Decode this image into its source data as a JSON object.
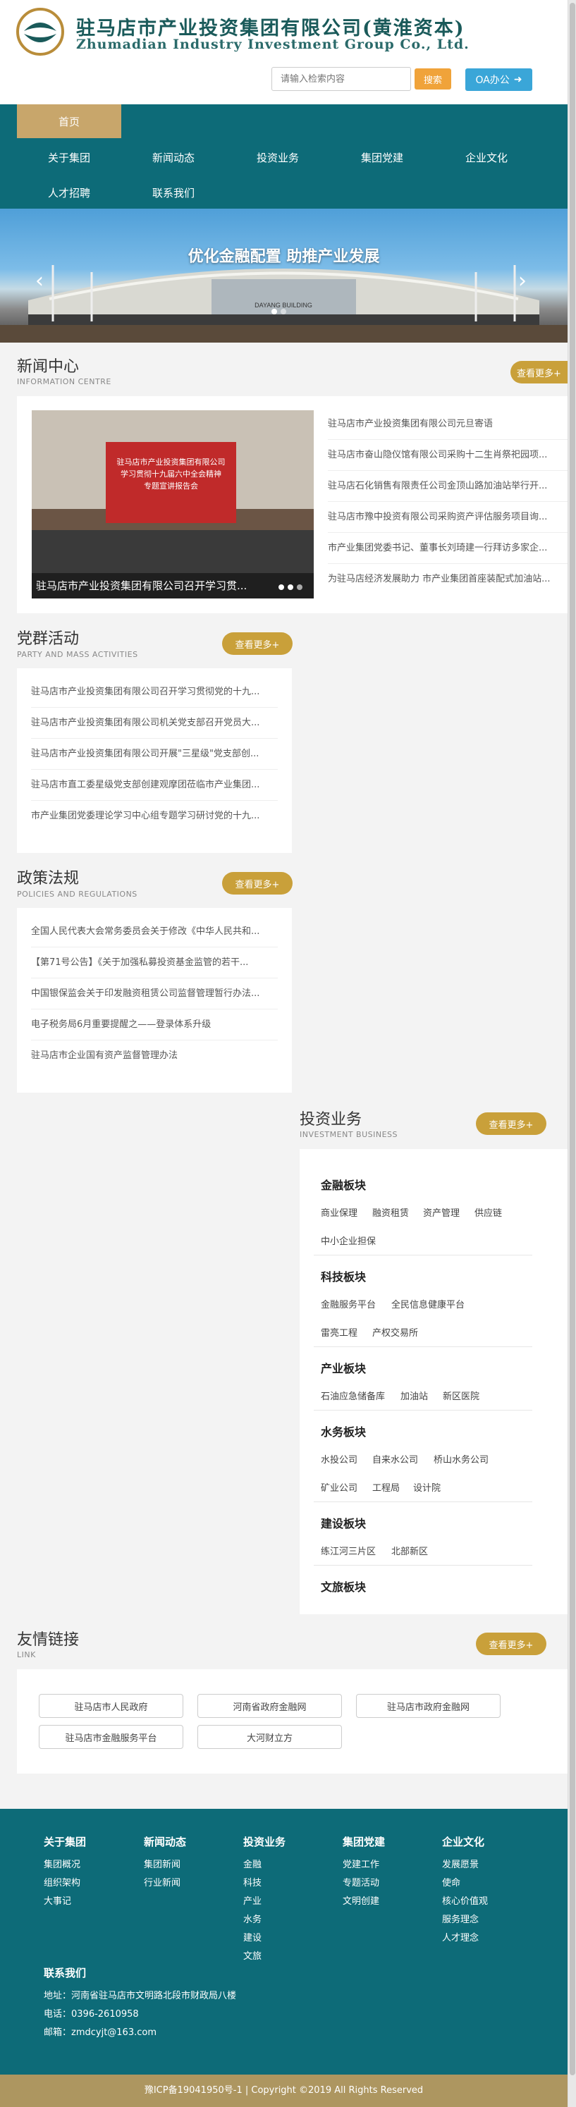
{
  "header": {
    "title_cn": "驻马店市产业投资集团有限公司(黄淮资本)",
    "title_en": "Zhumadian Industry Investment Group Co., Ltd.",
    "search_placeholder": "请输入检索内容",
    "search_label": "搜索",
    "oa_label": "OA办公"
  },
  "nav": {
    "home": "首页",
    "items": [
      "关于集团",
      "新闻动态",
      "投资业务",
      "集团党建",
      "企业文化",
      "人才招聘",
      "联系我们"
    ]
  },
  "banner": {
    "slogan": "优化金融配置  助推产业发展",
    "sign": "DAYANG BUILDING"
  },
  "news": {
    "title": "新闻中心",
    "subtitle": "INFORMATION CENTRE",
    "more": "查看更多+",
    "photo_caption": "驻马店市产业投资集团有限公司召开学习贯...",
    "photo_screen": [
      "驻马店市产业投资集团有限公司",
      "学习贯彻十九届六中全会精神",
      "专题宣讲报告会"
    ],
    "items": [
      "驻马店市产业投资集团有限公司元旦寄语",
      "驻马店市奋山隐仪馆有限公司采购十二生肖祭祀园项...",
      "驻马店石化销售有限责任公司金顶山路加油站举行开...",
      "驻马店市豫中投资有限公司采购资产评估服务项目询...",
      "市产业集团党委书记、董事长刘琦建一行拜访多家企...",
      "为驻马店经济发展助力 市产业集团首座装配式加油站..."
    ]
  },
  "party": {
    "title": "党群活动",
    "subtitle": "PARTY AND MASS ACTIVITIES",
    "more": "查看更多+",
    "items": [
      "驻马店市产业投资集团有限公司召开学习贯彻党的十九...",
      "驻马店市产业投资集团有限公司机关党支部召开党员大...",
      "驻马店市产业投资集团有限公司开展\"三星级\"党支部创...",
      "驻马店市直工委星级党支部创建观摩团莅临市产业集团...",
      "市产业集团党委理论学习中心组专题学习研讨党的十九..."
    ]
  },
  "policy": {
    "title": "政策法规",
    "subtitle": "POLICIES AND REGULATIONS",
    "more": "查看更多+",
    "items": [
      "全国人民代表大会常务委员会关于修改《中华人民共和...",
      "【第71号公告】《关于加强私募投资基金监管的若干...",
      "中国银保监会关于印发融资租赁公司监督管理暂行办法...",
      "电子税务局6月重要提醒之——登录体系升级",
      "驻马店市企业国有资产监督管理办法"
    ]
  },
  "invest": {
    "title": "投资业务",
    "subtitle": "INVESTMENT BUSINESS",
    "more": "查看更多+",
    "categories": [
      {
        "name": "金融板块",
        "tags": [
          "商业保理",
          "融资租赁",
          "资产管理",
          "供应链",
          "中小企业担保"
        ]
      },
      {
        "name": "科技板块",
        "tags": [
          "金融服务平台",
          "全民信息健康平台",
          "雷亮工程",
          "产权交易所"
        ]
      },
      {
        "name": "产业板块",
        "tags": [
          "石油应急储备库",
          "加油站",
          "新区医院"
        ]
      },
      {
        "name": "水务板块",
        "tags": [
          "水投公司",
          "自来水公司",
          "桥山水务公司",
          "矿业公司",
          "工程局",
          "设计院"
        ]
      },
      {
        "name": "建设板块",
        "tags": [
          "练江河三片区",
          "北部新区"
        ]
      },
      {
        "name": "文旅板块",
        "tags": []
      }
    ]
  },
  "links": {
    "title": "友情链接",
    "subtitle": "LINK",
    "more": "查看更多+",
    "items": [
      "驻马店市人民政府",
      "河南省政府金融网",
      "驻马店市政府金融网",
      "驻马店市金融服务平台",
      "大河财立方"
    ]
  },
  "footer": {
    "columns": [
      {
        "title": "关于集团",
        "items": [
          "集团概况",
          "组织架构",
          "大事记"
        ]
      },
      {
        "title": "新闻动态",
        "items": [
          "集团新闻",
          "行业新闻"
        ]
      },
      {
        "title": "投资业务",
        "items": [
          "金融",
          "科技",
          "产业",
          "水务",
          "建设",
          "文旅"
        ]
      },
      {
        "title": "集团党建",
        "items": [
          "党建工作",
          "专题活动",
          "文明创建"
        ]
      },
      {
        "title": "企业文化",
        "items": [
          "发展愿景",
          "使命",
          "核心价值观",
          "服务理念",
          "人才理念"
        ]
      }
    ],
    "contact_title": "联系我们",
    "address": "地址：河南省驻马店市文明路北段市财政局八楼",
    "phone": "电话：0396-2610958",
    "email": "邮箱：zmdcyjt@163.com",
    "copyright": "豫ICP备19041950号-1 | Copyright ©2019 All Rights Reserved"
  },
  "colors": {
    "teal": "#0d6b78",
    "gold": "#c9a03a",
    "home_tab": "#c8a66b",
    "oa_blue": "#3aa6d8",
    "search_orange": "#f0a33a"
  }
}
